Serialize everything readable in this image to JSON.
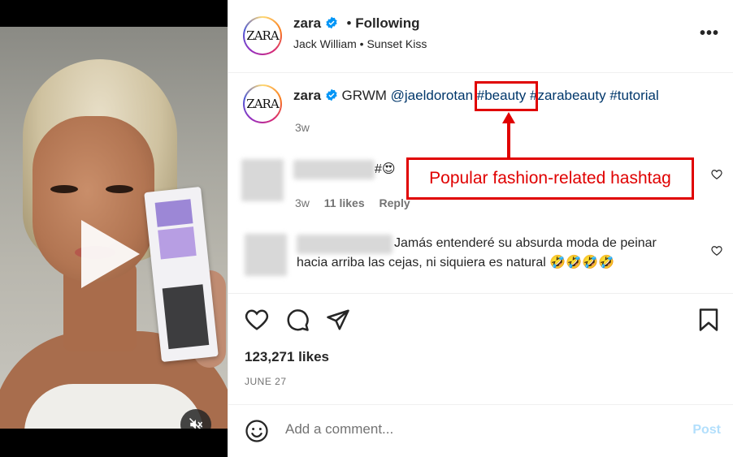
{
  "post": {
    "header": {
      "username": "zara",
      "separator": "•",
      "follow_status": "Following",
      "audio": "Jack William • Sunset Kiss",
      "avatar_text": "ZARA",
      "more_label": "•••"
    },
    "caption": {
      "username": "zara",
      "text_prefix": "GRWM",
      "mention": "@jaeldorotan",
      "hashtags": [
        "#beauty",
        "#zarabeauty",
        "#tutorial"
      ],
      "time": "3w"
    },
    "comments": [
      {
        "text": "#😍",
        "time": "3w",
        "likes": "11 likes",
        "reply": "Reply"
      },
      {
        "text_line1": "Jamás entenderé su absurda moda de peinar",
        "text_line2": "hacia arriba las cejas, ni siquiera es natural 🤣🤣🤣🤣"
      }
    ],
    "likes": "123,271 likes",
    "date": "JUNE 27",
    "add_comment": {
      "placeholder": "Add a comment...",
      "post_label": "Post"
    }
  },
  "annotation": {
    "label": "Popular fashion-related hashtag",
    "color": "#e00000"
  },
  "colors": {
    "link": "#00376b",
    "muted": "#737373",
    "post_button": "#b2dffc",
    "verified": "#0095f6"
  },
  "icons": [
    "play-icon",
    "mute-icon",
    "verified-icon",
    "more-icon",
    "heart-icon",
    "comment-icon",
    "share-icon",
    "bookmark-icon",
    "smiley-icon"
  ]
}
